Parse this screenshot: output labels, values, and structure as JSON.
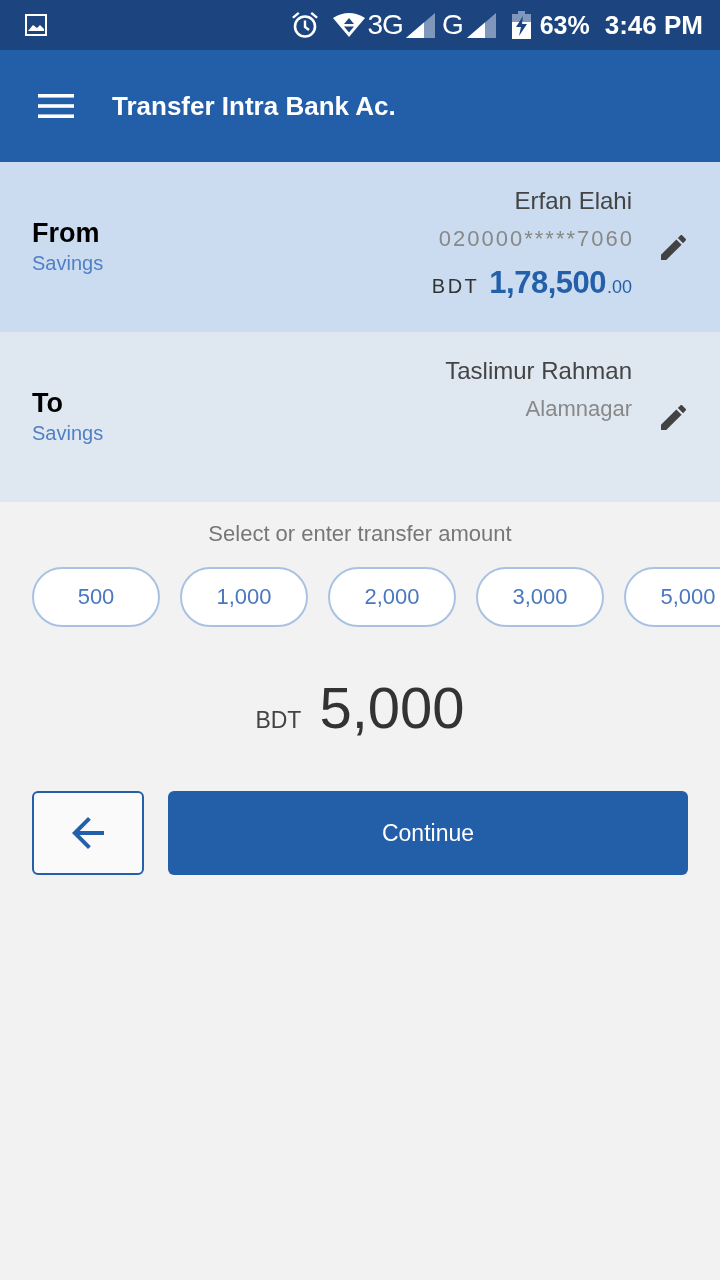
{
  "status_bar": {
    "network_1": "3G",
    "network_2": "G",
    "battery": "63%",
    "time": "3:46 PM"
  },
  "app_bar": {
    "title": "Transfer Intra Bank Ac."
  },
  "accounts": [
    {
      "kind": "from",
      "label": "From",
      "type": "Savings",
      "name": "Erfan Elahi",
      "detail": "020000*****7060",
      "balance": {
        "currency": "BDT",
        "whole": "1,78,500",
        "fraction": ".00"
      }
    },
    {
      "kind": "to",
      "label": "To",
      "type": "Savings",
      "name": "Taslimur Rahman",
      "detail": "Alamnagar"
    }
  ],
  "amount_prompt": "Select or enter transfer amount",
  "quick_amounts": [
    {
      "label": "500",
      "selected": false
    },
    {
      "label": "1,000",
      "selected": false
    },
    {
      "label": "2,000",
      "selected": false
    },
    {
      "label": "3,000",
      "selected": false
    },
    {
      "label": "5,000",
      "selected": false
    }
  ],
  "amount": {
    "currency": "BDT",
    "value": "5,000"
  },
  "continue_button": "Continue"
}
